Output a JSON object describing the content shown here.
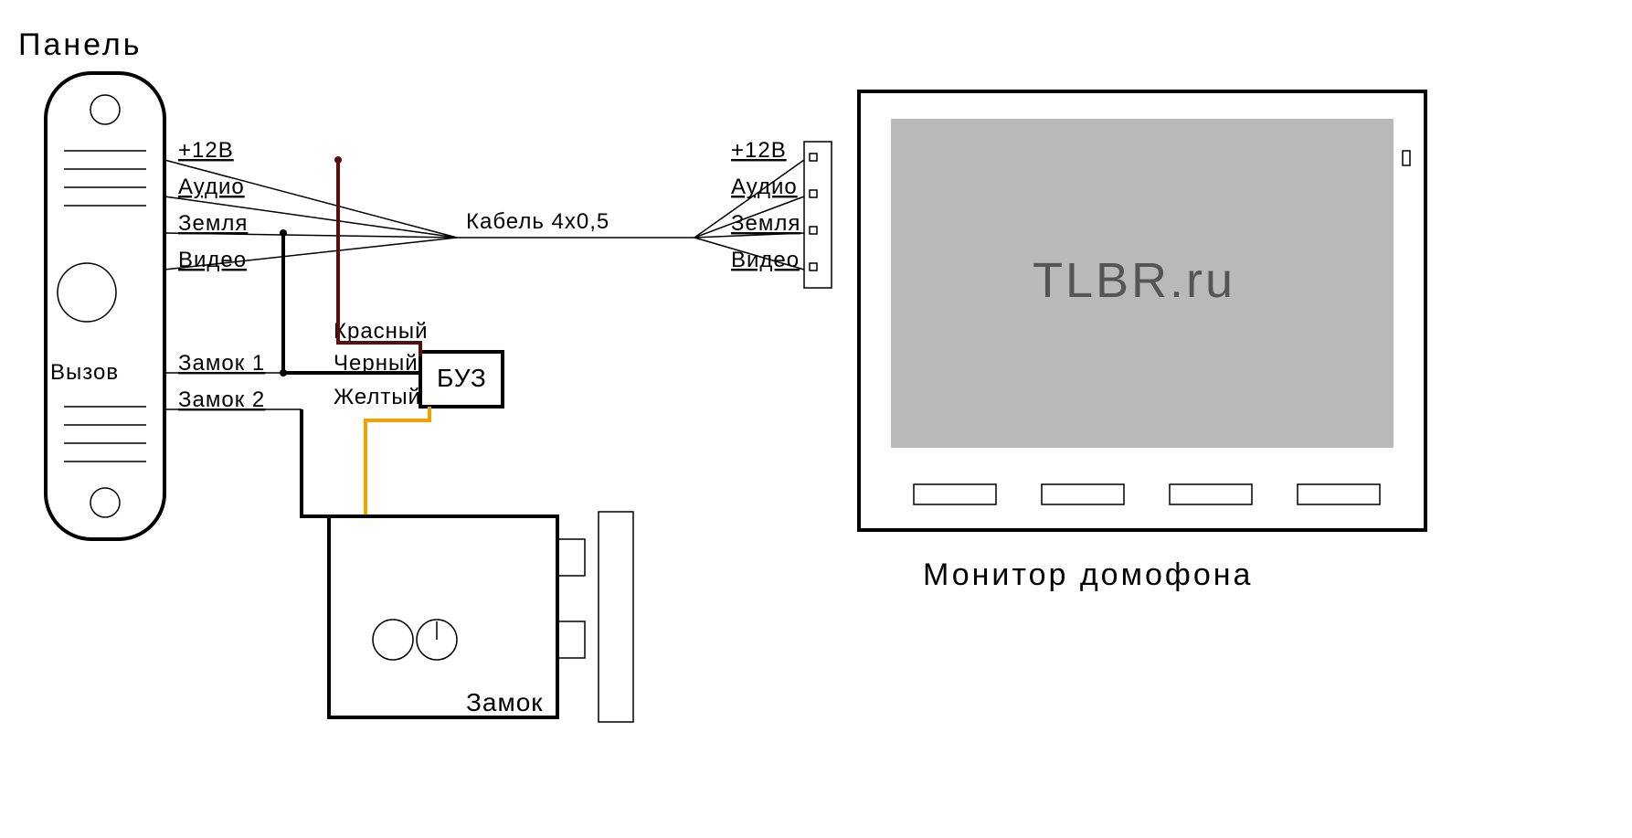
{
  "title_panel": "Панель",
  "title_monitor": "Монитор домофона",
  "panel": {
    "call_button": "Вызов"
  },
  "signal_lines_left": {
    "l1": "+12В",
    "l2": "Аудио",
    "l3": "Земля",
    "l4": "Видео",
    "lock1": "Замок 1",
    "lock2": "Замок 2"
  },
  "signal_lines_right": {
    "l1": "+12В",
    "l2": "Аудио",
    "l3": "Земля",
    "l4": "Видео"
  },
  "cable_label": "Кабель 4х0,5",
  "buz": {
    "label": "БУЗ",
    "wire_red": "Красный",
    "wire_black": "Черный",
    "wire_yellow": "Желтый"
  },
  "lock": {
    "label": "Замок"
  },
  "monitor": {
    "screen_text": "TLBR.ru"
  },
  "colors": {
    "red": "#5a0d0d",
    "black": "#000000",
    "yellow": "#f2a000",
    "screen_fill": "#b9b9b9"
  }
}
